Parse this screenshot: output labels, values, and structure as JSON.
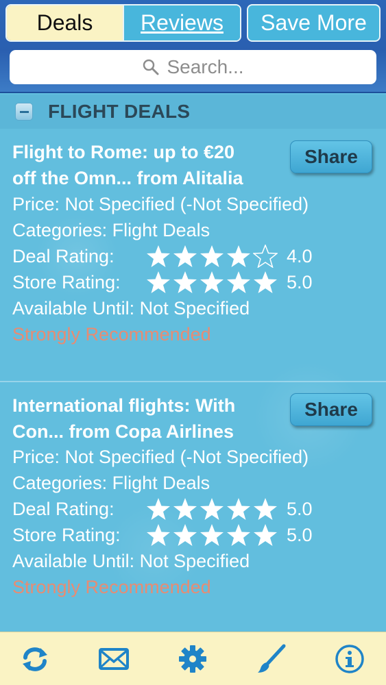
{
  "header": {
    "tabs": [
      {
        "label": "Deals",
        "active": true
      },
      {
        "label": "Reviews",
        "active": false
      }
    ],
    "save_more_label": "Save More",
    "search": {
      "placeholder": "Search...",
      "icon": "search-icon"
    }
  },
  "section": {
    "title": "FLIGHT DEALS",
    "collapse_icon": "minus-icon"
  },
  "deals": [
    {
      "title_line1": "Flight to Rome: up to €20",
      "title_line2": "off the Omn... from Alitalia",
      "share_label": "Share",
      "price": "Price: Not Specified (-Not Specified)",
      "categories": "Categories: Flight Deals",
      "deal_rating_label": "Deal Rating:",
      "deal_rating": 4,
      "deal_rating_text": "4.0",
      "store_rating_label": "Store Rating:",
      "store_rating": 5,
      "store_rating_text": "5.0",
      "available": "Available Until: Not Specified",
      "recommendation": "Strongly Recommended"
    },
    {
      "title_line1": "International flights: With",
      "title_line2": "Con... from Copa Airlines",
      "share_label": "Share",
      "price": "Price: Not Specified (-Not Specified)",
      "categories": "Categories: Flight Deals",
      "deal_rating_label": "Deal Rating:",
      "deal_rating": 5,
      "deal_rating_text": "5.0",
      "store_rating_label": "Store Rating:",
      "store_rating": 5,
      "store_rating_text": "5.0",
      "available": "Available Until: Not Specified",
      "recommendation": "Strongly Recommended"
    }
  ],
  "colors": {
    "header_bg": "#2c67b8",
    "content_bg": "#62bede",
    "tabbar_bg": "#faf3c4",
    "icon_blue": "#1f84c8",
    "recommend": "#e78c73"
  },
  "tabbar": {
    "icons": [
      "refresh-icon",
      "mail-icon",
      "gear-icon",
      "brush-icon",
      "info-icon"
    ]
  }
}
